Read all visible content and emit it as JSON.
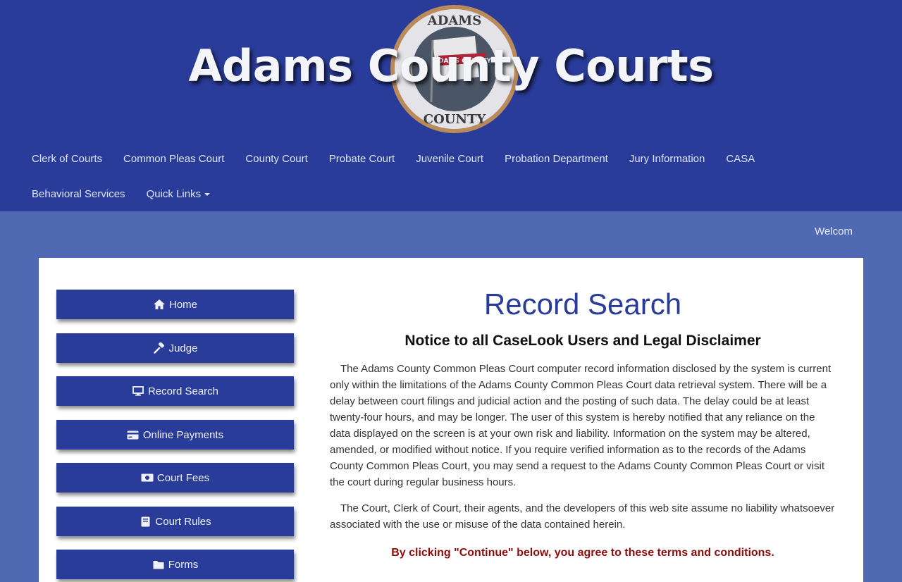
{
  "header": {
    "title": "Adams County Courts",
    "seal": {
      "top_text": "ADAMS",
      "bottom_text": "COUNTY",
      "banner_text": "ADAMS COUNTY",
      "colors": {
        "ring": "#b98a5a",
        "disc": "#4a5566",
        "flag": "#e8e8ea",
        "banner": "#b0253a"
      }
    }
  },
  "nav": {
    "items": [
      "Clerk of Courts",
      "Common Pleas Court",
      "County Court",
      "Probate Court",
      "Juvenile Court",
      "Probation Department",
      "Jury Information",
      "CASA",
      "Behavioral Services"
    ],
    "quick_links": "Quick Links"
  },
  "marquee": {
    "text": "Welcom"
  },
  "sidebar": {
    "buttons": [
      {
        "label": "Home",
        "icon": "home-icon"
      },
      {
        "label": "Judge",
        "icon": "gavel-icon"
      },
      {
        "label": "Record Search",
        "icon": "monitor-icon"
      },
      {
        "label": "Online Payments",
        "icon": "credit-card-icon"
      },
      {
        "label": "Court Fees",
        "icon": "money-icon"
      },
      {
        "label": "Court Rules",
        "icon": "book-icon"
      },
      {
        "label": "Forms",
        "icon": "folder-icon"
      }
    ]
  },
  "main": {
    "title": "Record Search",
    "notice_heading": "Notice to all CaseLook Users and Legal Disclaimer",
    "paragraphs": [
      "The Adams County Common Pleas Court computer record information disclosed by the system is current only within the limitations of the Adams County Common Pleas Court data retrieval system. There will be a delay between court filings and judicial action and the posting of such data. The delay could be at least twenty-four hours, and may be longer. The user of this system is hereby notified that any reliance on the data displayed on the screen is at your own risk and liability. Information on the system may be altered, amended, or modified without notice. If you require verified information as to the records of the Adams County Common Pleas Court, you may send a request to the Adams County Common Pleas Court or visit the court during regular business hours.",
      "The Court, Clerk of Court, their agents, and the developers of this web site assume no liability whatsoever associated with the use or misuse of the data contained herein."
    ],
    "agree_text": "By clicking \"Continue\" below, you agree to these terms and conditions."
  },
  "colors": {
    "header_bg": "#2a3c9a",
    "page_bg": "#5069b3",
    "button_bg": "#2a3c9a",
    "title_color": "#2a3c9a",
    "agree_color": "#8b0d0d"
  }
}
